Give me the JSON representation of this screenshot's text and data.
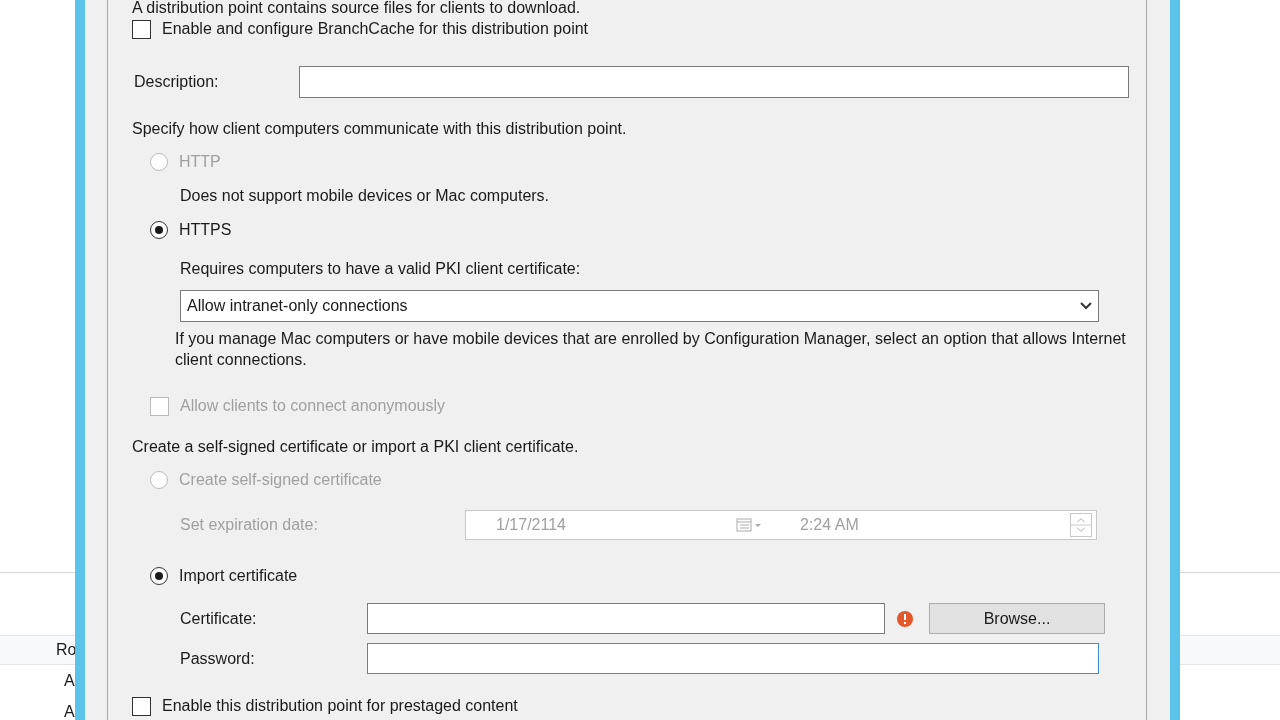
{
  "background_window": {
    "column_header": "Ro",
    "rows": [
      "A",
      "A"
    ]
  },
  "dialog": {
    "intro": "A distribution point contains source files for clients to download.",
    "branchcache": {
      "label": "Enable and configure BranchCache for this distribution point",
      "checked": false
    },
    "description": {
      "label": "Description:"
    },
    "protocol_prompt": "Specify how client computers communicate with this distribution point.",
    "protocols": [
      {
        "label": "HTTP",
        "selected": false,
        "disabled": true,
        "note": "Does not support mobile devices or Mac computers."
      },
      {
        "label": "HTTPS",
        "selected": true,
        "disabled": false,
        "note": "Requires computers to have a valid PKI client certificate:"
      }
    ],
    "connection_dropdown": {
      "value": "Allow intranet-only connections"
    },
    "connection_help": "If you manage Mac computers or have mobile devices that are enrolled by Configuration Manager, select an option that allows Internet client connections.",
    "anonymous": {
      "label": "Allow clients to connect anonymously",
      "checked": false,
      "disabled": true
    },
    "certificate_prompt": "Create a self-signed certificate or import a PKI client certificate.",
    "certificate_options": [
      {
        "label": "Create self-signed certificate",
        "selected": false,
        "disabled": true
      },
      {
        "label": "Import certificate",
        "selected": true,
        "disabled": false
      }
    ],
    "expiration": {
      "label": "Set expiration date:",
      "date": "1/17/2114",
      "time": "2:24 AM",
      "disabled": true
    },
    "certificate": {
      "label": "Certificate:"
    },
    "browse_button": "Browse...",
    "password": {
      "label": "Password:",
      "focused": true
    },
    "prestaged": {
      "label": "Enable this distribution point for prestaged content",
      "checked": false
    }
  }
}
